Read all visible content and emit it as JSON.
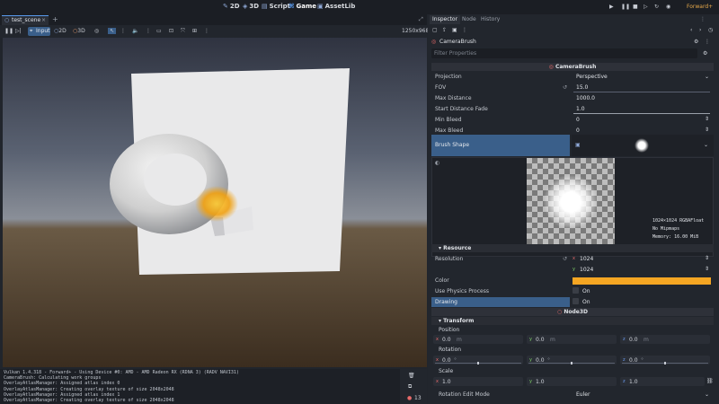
{
  "topbar": {
    "modes": [
      {
        "label": "2D",
        "icon": "2d-icon"
      },
      {
        "label": "3D",
        "icon": "3d-icon"
      },
      {
        "label": "Script",
        "icon": "script-icon"
      },
      {
        "label": "Game",
        "icon": "game-icon",
        "active": true
      },
      {
        "label": "AssetLib",
        "icon": "assetlib-icon"
      }
    ],
    "renderer": "Forward+"
  },
  "scene_tabs": {
    "current": "test_scene",
    "add": "+"
  },
  "viewport_toolbar": {
    "input_label": "Input",
    "btn_2d": "2D",
    "btn_3d": "3D",
    "resolution": "1250x968"
  },
  "console": {
    "lines": [
      "Vulkan 1.4.318 - Forward+ - Using Device #0: AMD - AMD Radeon RX (RDNA 3) (RADV NAVI31)",
      "",
      "CameraBrush: Calculating work groups",
      "OverlayAtlasManager: Assigned atlas index 0",
      "OverlayAtlasManager: Creating overlay texture of size 2048x2048",
      "OverlayAtlasManager: Assigned atlas index 1",
      "OverlayAtlasManager: Creating overlay texture of size 2048x2048"
    ],
    "count": "13"
  },
  "inspector": {
    "tabs": [
      "Inspector",
      "Node",
      "History"
    ],
    "node_name": "CameraBrush",
    "filter_placeholder": "Filter Properties",
    "class_header": "CameraBrush",
    "props": {
      "projection_label": "Projection",
      "projection_value": "Perspective",
      "fov_label": "FOV",
      "fov_value": "15.0",
      "max_distance_label": "Max Distance",
      "max_distance_value": "1000.0",
      "start_fade_label": "Start Distance Fade",
      "start_fade_value": "1.0",
      "min_bleed_label": "Min Bleed",
      "min_bleed_value": "0",
      "max_bleed_label": "Max Bleed",
      "max_bleed_value": "0",
      "brush_shape_label": "Brush Shape"
    },
    "texture_info": {
      "size": "1024×1024 RGBAFloat",
      "mipmaps": "No Mipmaps",
      "memory": "Memory: 16.00 MiB"
    },
    "resource": {
      "header": "Resource",
      "resolution_label": "Resolution",
      "res_x_axis": "x",
      "res_x": "1024",
      "res_y_axis": "y",
      "res_y": "1024",
      "color_label": "Color",
      "color_hex": "#f5a623",
      "physics_label": "Use Physics Process",
      "physics_value": "On",
      "drawing_label": "Drawing",
      "drawing_value": "On"
    },
    "node3d": {
      "header": "Node3D",
      "transform_header": "Transform",
      "position_label": "Position",
      "pos_x": "0.0",
      "pos_y": "0.0",
      "pos_z": "0.0",
      "unit_m": "m",
      "rotation_label": "Rotation",
      "rot_x": "0.0",
      "rot_y": "0.0",
      "rot_z": "0.0",
      "unit_deg": "°",
      "scale_label": "Scale",
      "scale_x": "1.0",
      "scale_y": "1.0",
      "scale_z": "1.0",
      "rot_mode_label": "Rotation Edit Mode",
      "rot_mode_value": "Euler",
      "axis_x": "x",
      "axis_y": "y",
      "axis_z": "z"
    }
  },
  "colors": {
    "accent": "#5a9cf0",
    "brush": "#f5a623",
    "selected_row": "#3a5f8a"
  }
}
